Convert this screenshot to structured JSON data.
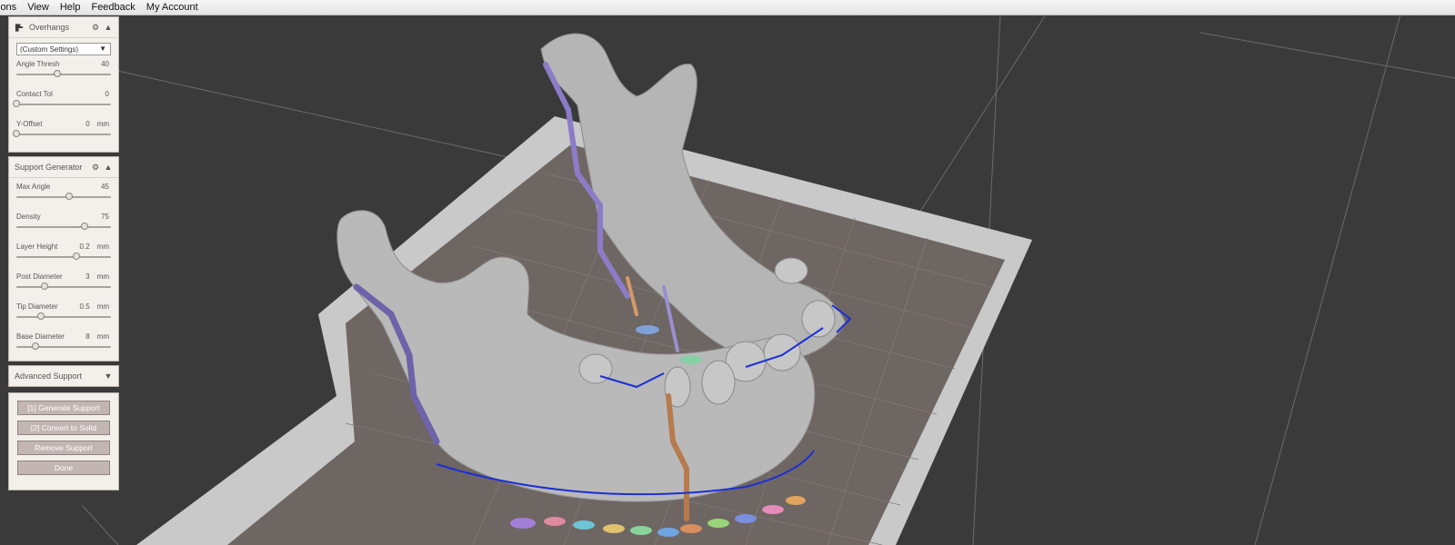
{
  "menu": [
    "ions",
    "View",
    "Help",
    "Feedback",
    "My Account"
  ],
  "overhangs": {
    "title": "Overhangs",
    "preset": "(Custom Settings)",
    "sliders": [
      {
        "label": "Angle Thresh",
        "value": "40",
        "unit": "",
        "level": 0.43
      },
      {
        "label": "Contact Tol",
        "value": "0",
        "unit": "",
        "level": 0.0
      },
      {
        "label": "Y-Offset",
        "value": "0",
        "unit": "mm",
        "level": 0.0
      }
    ]
  },
  "support_generator": {
    "title": "Support Generator",
    "sliders": [
      {
        "label": "Max Angle",
        "value": "45",
        "unit": "",
        "level": 0.56
      },
      {
        "label": "Density",
        "value": "75",
        "unit": "",
        "level": 0.72
      },
      {
        "label": "Layer Height",
        "value": "0.2",
        "unit": "mm",
        "level": 0.63
      },
      {
        "label": "Post Diameter",
        "value": "3",
        "unit": "mm",
        "level": 0.3
      },
      {
        "label": "Tip Diameter",
        "value": "0.5",
        "unit": "mm",
        "level": 0.26
      },
      {
        "label": "Base Diameter",
        "value": "8",
        "unit": "mm",
        "level": 0.2
      }
    ]
  },
  "advanced_support": {
    "title": "Advanced Support"
  },
  "actions": {
    "generate": "[1] Generate Support",
    "convert": "[2] Convert to Solid",
    "remove": "Remove Support",
    "done": "Done"
  },
  "icons": {
    "overhangs": "overhang-tool-icon",
    "settings": "gear-icon",
    "collapse": "chevron-up-icon",
    "expand": "chevron-down-icon"
  },
  "colors": {
    "background": "#3a3a3a",
    "bed_frame": "#c8c8c8",
    "bed_plate": "#6e6663",
    "panel": "#f3f0ec",
    "button": "#c3b6b2",
    "support_purple": "#7d6fb6",
    "support_brown": "#b97a4d",
    "model": "#b7b7b7"
  }
}
